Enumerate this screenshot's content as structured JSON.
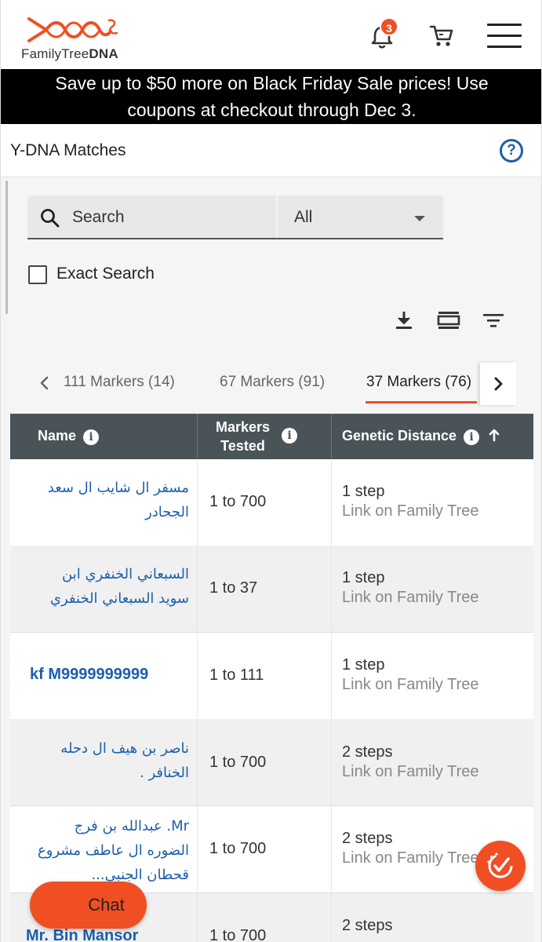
{
  "header": {
    "logo_text_regular": "FamilyTree",
    "logo_text_bold": "DNA",
    "notification_count": "3"
  },
  "promo": {
    "line1": "Save up to $50 more on Black Friday Sale prices! Use",
    "line2": "coupons at checkout through Dec 3."
  },
  "page": {
    "title": "Y-DNA Matches",
    "help_label": "?"
  },
  "search": {
    "placeholder": "Search",
    "filter_value": "All",
    "exact_label": "Exact Search",
    "exact_checked": false
  },
  "toolbar_icons": [
    "download-icon",
    "view-density-icon",
    "filter-icon"
  ],
  "tabs": [
    {
      "label": "111 Markers (14)",
      "active": false
    },
    {
      "label": "67 Markers (91)",
      "active": false
    },
    {
      "label": "37 Markers (76)",
      "active": true
    }
  ],
  "table": {
    "columns": [
      {
        "label": "Name"
      },
      {
        "label_line1": "Markers",
        "label_line2": "Tested"
      },
      {
        "label": "Genetic Distance",
        "sort": "ascending"
      }
    ],
    "rows": [
      {
        "name_line1": "مسفر ال شايب ال سعد",
        "name_line2": "الجحادر",
        "markers": "1 to 700",
        "distance": "1 step",
        "tree_link": "Link on Family Tree"
      },
      {
        "name_line1": "السبعاني الخنفري ابن",
        "name_line2": "سويد السبعاني الخنفري",
        "markers": "1 to 37",
        "distance": "1 step",
        "tree_link": "Link on Family Tree"
      },
      {
        "name_line1": "kf M9999999999",
        "name_line2": "",
        "markers": "1 to 111",
        "distance": "1 step",
        "tree_link": "Link on Family Tree"
      },
      {
        "name_line1": "ناصر بن هيف ال دحله",
        "name_line2": "الخنافر .",
        "markers": "1 to 700",
        "distance": "2 steps",
        "tree_link": "Link on Family Tree"
      },
      {
        "name_line1": "Mr. عبدالله بن فرج",
        "name_line2": "الضوره ال عاطف مشروع",
        "name_line3": "قحطان الجنبي...",
        "markers": "1 to 700",
        "distance": "2 steps",
        "tree_link": "Link on Family Tree"
      },
      {
        "name_line1": "Mr. Bin Mansor",
        "name_line2": "",
        "markers": "1 to 700",
        "distance": "2 steps",
        "tree_link": ""
      }
    ]
  },
  "chat": {
    "label": "Chat"
  },
  "colors": {
    "accent": "#f04e23",
    "link": "#1b5fab",
    "header_bg": "#4a5357",
    "promo_bg": "#000000"
  }
}
